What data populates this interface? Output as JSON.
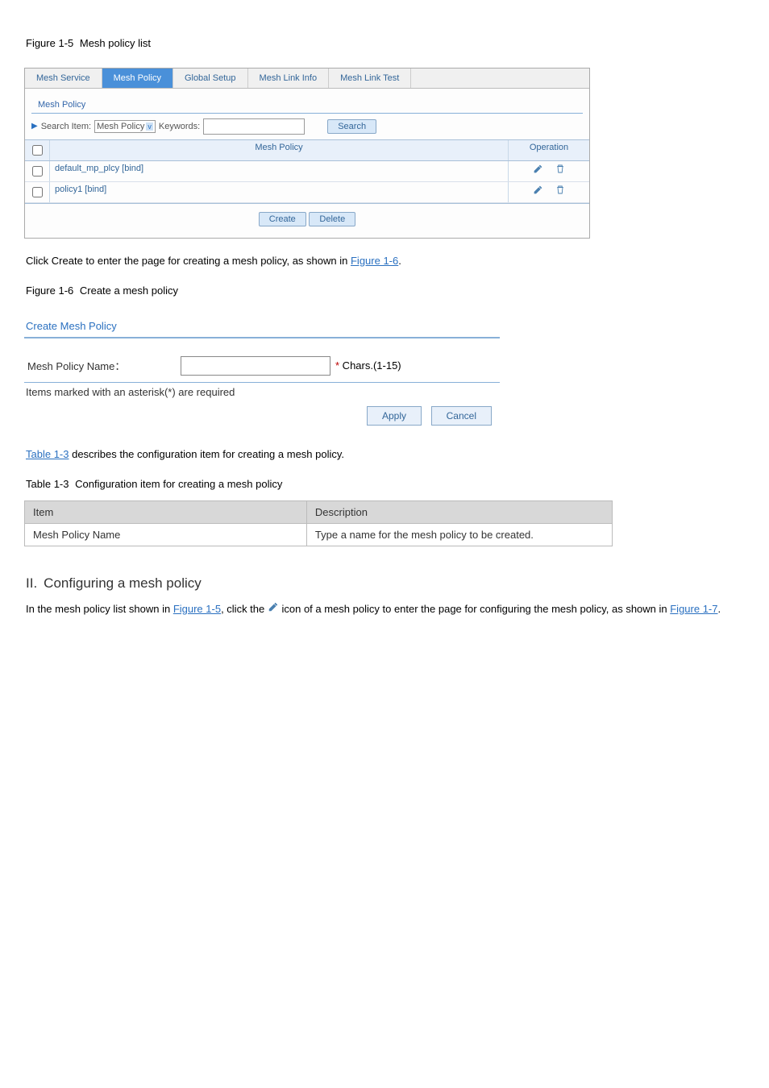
{
  "doc": {
    "fig1_label": "Figure 1-5",
    "fig1_title": "Mesh policy list",
    "tabs": [
      "Mesh Service",
      "Mesh Policy",
      "Global Setup",
      "Mesh Link Info",
      "Mesh Link Test"
    ],
    "active_tab_index": 1,
    "subhead": "Mesh Policy",
    "search_item_label": "Search Item:",
    "search_item_value": "Mesh Policy",
    "keywords_label": "Keywords:",
    "search_btn": "Search",
    "grid_head_name": "Mesh Policy",
    "grid_head_op": "Operation",
    "rows": [
      {
        "name": "default_mp_plcy [bind]"
      },
      {
        "name": "policy1 [bind]"
      }
    ],
    "create_btn": "Create",
    "delete_btn": "Delete",
    "step_create": "Click Create to enter the page for creating a mesh policy, as shown in",
    "fig2_ref": "Figure 1-6",
    "fig2_label": "Figure 1-6",
    "fig2_title": "Create a mesh policy",
    "p2_title": "Create Mesh Policy",
    "form_label": "Mesh Policy Name：",
    "form_hint_star": "*",
    "form_hint_rest": " Chars.(1-15)",
    "req_note": "Items marked with an asterisk(*) are required",
    "apply_btn": "Apply",
    "cancel_btn": "Cancel",
    "table1_ref": "Table 1-3",
    "table1_desc": " describes the configuration item for creating a mesh policy.",
    "table1_label": "Table 1-3",
    "table1_title": "Configuration item for creating a mesh policy",
    "table_col1": "Item",
    "table_col2": "Description",
    "table_row1_c1": "Mesh Policy Name",
    "table_row1_c2": "Type a name for the mesh policy to be created.",
    "h2_num": "II.",
    "h2_title": "Configuring a mesh policy",
    "h2_body_1": "In the mesh policy list shown in ",
    "h2_fig_ref": "Figure 1-5",
    "h2_body_2": ", click the ",
    "h2_body_3": " icon of a mesh policy to enter the page for configuring the mesh policy, as shown in ",
    "h2_fig_ref2": "Figure 1-7"
  }
}
